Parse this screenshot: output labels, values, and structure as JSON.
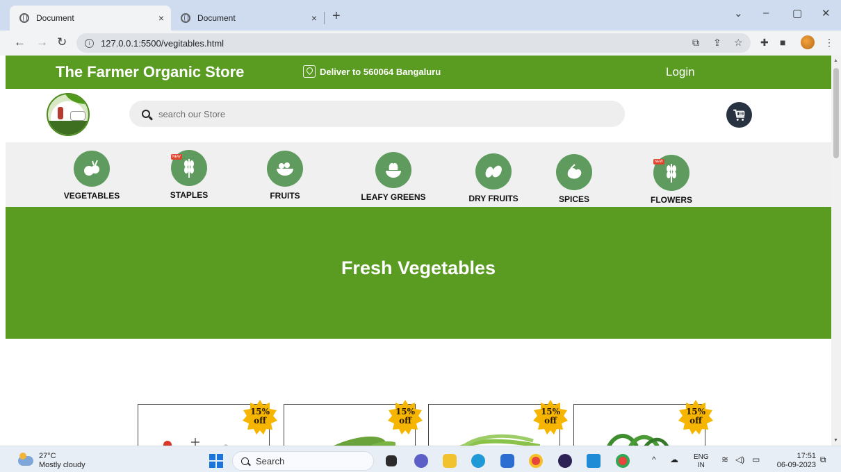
{
  "browser": {
    "tabs": [
      {
        "title": "Document",
        "active": true
      },
      {
        "title": "Document",
        "active": false
      }
    ],
    "new_tab_symbol": "+",
    "close_symbol": "×",
    "url": "127.0.0.1:5500/vegitables.html",
    "window_controls": [
      "⌄",
      "–",
      "▢",
      "✕"
    ]
  },
  "header": {
    "store_name": "The Farmer Organic Store",
    "deliver_text": "Deliver to 560064 Bangaluru",
    "login_label": "Login"
  },
  "search": {
    "placeholder": "search our Store"
  },
  "categories": [
    {
      "label": "VEGETABLES",
      "icon": "vegetables-icon",
      "new": false
    },
    {
      "label": "STAPLES",
      "icon": "wheat-icon",
      "new": true
    },
    {
      "label": "FRUITS",
      "icon": "fruit-bowl-icon",
      "new": false
    },
    {
      "label": "LEAFY GREENS",
      "icon": "leafy-greens-icon",
      "new": false
    },
    {
      "label": "DRY FRUITS",
      "icon": "almonds-icon",
      "new": false
    },
    {
      "label": "SPICES",
      "icon": "spices-icon",
      "new": false
    },
    {
      "label": "FLOWERS",
      "icon": "wheat-icon",
      "new": true
    }
  ],
  "new_tag_text": "NEW",
  "hero": {
    "title": "Fresh Vegetables"
  },
  "products": [
    {
      "discount_pct": "15%",
      "discount_word": "off",
      "image": "tomato-image"
    },
    {
      "discount_pct": "15%",
      "discount_word": "off",
      "image": "cucumber-image"
    },
    {
      "discount_pct": "15%",
      "discount_word": "off",
      "image": "beans-image"
    },
    {
      "discount_pct": "15%",
      "discount_word": "off",
      "image": "green-chili-image"
    }
  ],
  "taskbar": {
    "temperature": "27°C",
    "weather": "Mostly cloudy",
    "search_label": "Search",
    "lang_top": "ENG",
    "lang_bottom": "IN",
    "time": "17:51",
    "date": "06-09-2023"
  },
  "colors": {
    "brand_green": "#5a9c22",
    "category_circle": "#5f9b5e",
    "cart_bg": "#283241",
    "badge_gold": "#f6b500"
  }
}
